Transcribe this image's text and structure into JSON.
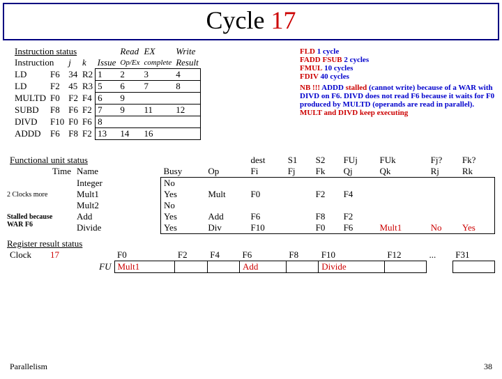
{
  "title": {
    "prefix": "Cycle ",
    "num": "17"
  },
  "instruction_status": {
    "label": "Instruction status",
    "headers": {
      "instruction": "Instruction",
      "j": "j",
      "k": "k",
      "issue": "Issue",
      "read": "Read",
      "opex": "Op/Ex",
      "ex": "EX",
      "complete": "complete",
      "write": "Write",
      "result": "Result"
    },
    "rows": [
      {
        "op": "LD",
        "d": "F6",
        "j": "34",
        "k": "R2",
        "issue": "1",
        "read": "2",
        "ex": "3",
        "write": "4"
      },
      {
        "op": "LD",
        "d": "F2",
        "j": "45",
        "k": "R3",
        "issue": "5",
        "read": "6",
        "ex": "7",
        "write": "8"
      },
      {
        "op": "MULTD",
        "d": "F0",
        "j": "F2",
        "k": "F4",
        "issue": "6",
        "read": "9",
        "ex": "",
        "write": ""
      },
      {
        "op": "SUBD",
        "d": "F8",
        "j": "F6",
        "k": "F2",
        "issue": "7",
        "read": "9",
        "ex": "11",
        "write": "12"
      },
      {
        "op": "DIVD",
        "d": "F10",
        "j": "F0",
        "k": "F6",
        "issue": "8",
        "read": "",
        "ex": "",
        "write": ""
      },
      {
        "op": "ADDD",
        "d": "F6",
        "j": "F8",
        "k": "F2",
        "issue": "13",
        "read": "14",
        "ex": "16",
        "write": ""
      }
    ]
  },
  "side_notes": {
    "latency_lines": [
      {
        "lhs": "FLD",
        "rhs": "1 cycle"
      },
      {
        "lhs": "FADD FSUB",
        "rhs": "2 cycles"
      },
      {
        "lhs": "FMUL",
        "rhs": "10 cycles"
      },
      {
        "lhs": "FDIV",
        "rhs": "40 cycles"
      }
    ],
    "nb_prefix": "NB !!! ",
    "nb_text1": "ADDD stalled (cannot write) because of a WAR with DIVD on F6. DIVD does not read F6 because it waits for F0 produced by MULTD (operands are read in parallel).",
    "nb_text2": "MULT and DIVD keep executing"
  },
  "fu_status": {
    "label": "Functional unit status",
    "time": "Time",
    "name": "Name",
    "headers": [
      "Busy",
      "Op",
      "dest",
      "S1",
      "S2",
      "FUj",
      "FUk",
      "Fj?",
      "Fk?"
    ],
    "subheaders": [
      "",
      "",
      "Fi",
      "Fj",
      "Fk",
      "Qj",
      "Qk",
      "Rj",
      "Rk"
    ],
    "clocks_more": "2  Clocks more",
    "stalled_note1": "Stalled because",
    "stalled_note2": "WAR F6",
    "rows": [
      {
        "name": "Integer",
        "busy": "No",
        "op": "",
        "fi": "",
        "fj": "",
        "fk": "",
        "qj": "",
        "qk": "",
        "rj": "",
        "rk": ""
      },
      {
        "name": "Mult1",
        "busy": "Yes",
        "op": "Mult",
        "fi": "F0",
        "fj": "",
        "fk": "F2",
        "qj": "F4",
        "qk": "",
        "rj": "",
        "rk": ""
      },
      {
        "name": "Mult2",
        "busy": "No",
        "op": "",
        "fi": "",
        "fj": "",
        "fk": "",
        "qj": "",
        "qk": "",
        "rj": "",
        "rk": ""
      },
      {
        "name": "Add",
        "busy": "Yes",
        "op": "Add",
        "fi": "F6",
        "fj": "",
        "fk": "F8",
        "qj": "F2",
        "qk": "",
        "rj": "",
        "rk": ""
      },
      {
        "name": "Divide",
        "busy": "Yes",
        "op": "Div",
        "fi": "F10",
        "fj": "",
        "fk": "F0",
        "qj": "F6",
        "qk": "Mult1",
        "rj": "No",
        "rk": "Yes"
      }
    ]
  },
  "reg_status": {
    "label": "Register result status",
    "clock_label": "Clock",
    "clock_val": "17",
    "fu_label": "FU",
    "regs": [
      "F0",
      "F2",
      "F4",
      "F6",
      "F8",
      "F10",
      "F12",
      "...",
      "F31"
    ],
    "fu": [
      "Mult1",
      "",
      "",
      "Add",
      "",
      "Divide",
      "",
      "",
      ""
    ]
  },
  "footer": {
    "left": "Parallelism",
    "right": "38"
  }
}
